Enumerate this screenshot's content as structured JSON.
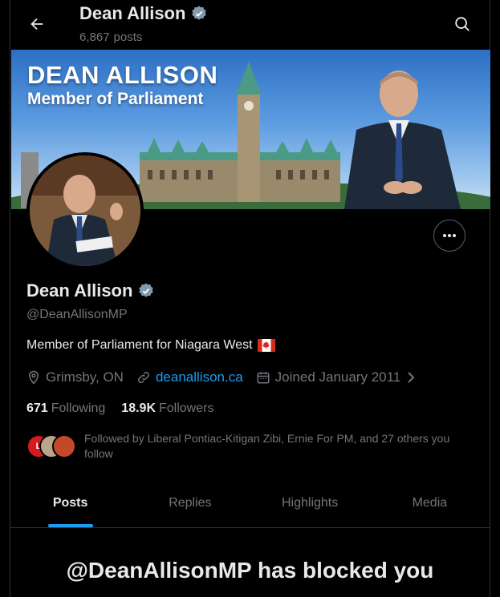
{
  "header": {
    "name": "Dean Allison",
    "posts_count": "6,867",
    "posts_label": "posts"
  },
  "banner": {
    "line1": "DEAN ALLISON",
    "line2": "Member of Parliament"
  },
  "profile": {
    "name": "Dean Allison",
    "handle": "@DeanAllisonMP",
    "bio": "Member of Parliament for Niagara West",
    "bio_flag": "canada-flag",
    "location": "Grimsby, ON",
    "website": "deanallison.ca",
    "joined": "Joined January 2011",
    "following_count": "671",
    "following_label": "Following",
    "followers_count": "18.9K",
    "followers_label": "Followers",
    "followed_by": "Followed by Liberal Pontiac-Kitigan Zibi, Ernie For PM, and 27 others you follow"
  },
  "tabs": [
    {
      "label": "Posts",
      "active": true
    },
    {
      "label": "Replies",
      "active": false
    },
    {
      "label": "Highlights",
      "active": false
    },
    {
      "label": "Media",
      "active": false
    }
  ],
  "blocked_message": "@DeanAllisonMP has blocked you",
  "colors": {
    "accent": "#1d9bf0",
    "verified": "#829aab",
    "muted": "#71767b"
  }
}
